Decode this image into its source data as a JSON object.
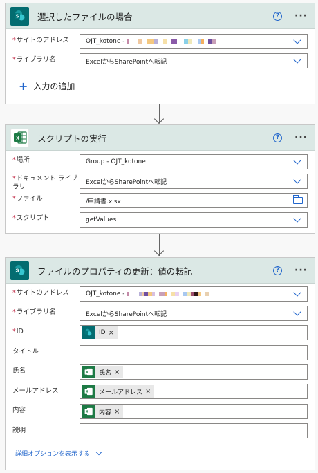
{
  "card1": {
    "title": "選択したファイルの場合",
    "icon": "sharepoint-icon",
    "site_label": "サイトのアドレス",
    "site_value": "OJT_kotone -",
    "library_label": "ライブラリ名",
    "library_value": "ExcelからSharePointへ転記",
    "add_input_label": "入力の追加"
  },
  "card2": {
    "title": "スクリプトの実行",
    "icon": "excel-icon",
    "location_label": "場所",
    "location_value": "Group - OJT_kotone",
    "doclib_label_line1": "ドキュメント ライブ",
    "doclib_label_line2": "ラリ",
    "doclib_value": "ExcelからSharePointへ転記",
    "file_label": "ファイル",
    "file_value": "/申請書.xlsx",
    "script_label": "スクリプト",
    "script_value": "getValues"
  },
  "card3": {
    "title": "ファイルのプロパティの更新：値の転記",
    "icon": "sharepoint-icon",
    "site_label": "サイトのアドレス",
    "site_value": "OJT_kotone -",
    "library_label": "ライブラリ名",
    "library_value": "ExcelからSharePointへ転記",
    "id_label": "ID",
    "id_token": "ID",
    "title_label": "タイトル",
    "name_label": "氏名",
    "name_token": "氏名",
    "email_label": "メールアドレス",
    "email_token": "メールアドレス",
    "content_label": "内容",
    "content_token": "内容",
    "desc_label": "説明",
    "advanced_label": "詳細オプションを表示する"
  },
  "common": {
    "help_icon_glyph": "?",
    "more_glyph": "···",
    "required_mark": "*",
    "token_remove": "×",
    "plus_glyph": "+"
  },
  "colors": {
    "header_bg": "#dbe8e5",
    "accent_blue": "#2266cc",
    "sharepoint_teal": "#036c70",
    "excel_green": "#1d7a45",
    "required_red": "#c4314b"
  }
}
